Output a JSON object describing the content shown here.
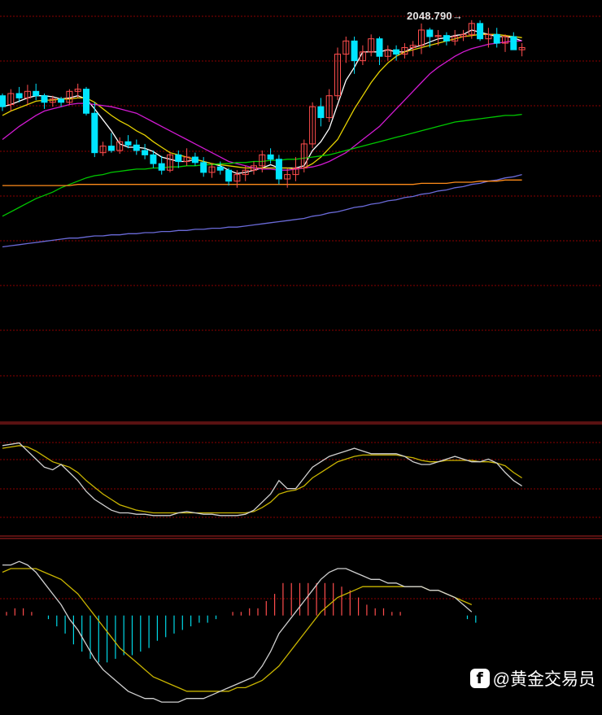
{
  "chart_data": {
    "type": "candlestick",
    "peak_label": "2048.790→",
    "colors": {
      "background": "#000000",
      "grid": "#8b0000",
      "panel_border": "#b22222",
      "candle_up": "#ff4d4d",
      "candle_down": "#00e5ff",
      "ma5": "#ffffff",
      "ma10": "#e6d200",
      "ma20": "#d21ad2",
      "ma60": "#00c800",
      "ma120": "#6a6ad8",
      "ma250": "#ff8c1a",
      "kdj_k": "#d0d0d0",
      "kdj_d": "#c8b400",
      "macd_dif": "#d0d0d0",
      "macd_dea": "#c8b400",
      "macd_pos": "#ff4d4d",
      "macd_neg": "#00d8e6"
    },
    "price_candles": [
      [
        1980,
        1982,
        1966,
        1970
      ],
      [
        1972,
        1986,
        1966,
        1982
      ],
      [
        1982,
        1988,
        1974,
        1978
      ],
      [
        1978,
        1990,
        1972,
        1984
      ],
      [
        1984,
        1991,
        1976,
        1980
      ],
      [
        1980,
        1982,
        1968,
        1974
      ],
      [
        1974,
        1980,
        1970,
        1977
      ],
      [
        1977,
        1979,
        1970,
        1974
      ],
      [
        1974,
        1986,
        1972,
        1984
      ],
      [
        1984,
        1991,
        1978,
        1986
      ],
      [
        1986,
        1988,
        1962,
        1964
      ],
      [
        1964,
        1974,
        1924,
        1928
      ],
      [
        1928,
        1938,
        1925,
        1934
      ],
      [
        1934,
        1946,
        1928,
        1930
      ],
      [
        1930,
        1942,
        1927,
        1938
      ],
      [
        1938,
        1944,
        1932,
        1935
      ],
      [
        1935,
        1940,
        1926,
        1930
      ],
      [
        1930,
        1936,
        1922,
        1926
      ],
      [
        1926,
        1930,
        1914,
        1918
      ],
      [
        1918,
        1925,
        1908,
        1912
      ],
      [
        1912,
        1928,
        1910,
        1926
      ],
      [
        1926,
        1930,
        1914,
        1920
      ],
      [
        1920,
        1932,
        1916,
        1924
      ],
      [
        1924,
        1928,
        1916,
        1919
      ],
      [
        1919,
        1924,
        1906,
        1910
      ],
      [
        1910,
        1918,
        1905,
        1915
      ],
      [
        1915,
        1920,
        1908,
        1912
      ],
      [
        1912,
        1914,
        1898,
        1902
      ],
      [
        1902,
        1912,
        1896,
        1908
      ],
      [
        1908,
        1916,
        1902,
        1912
      ],
      [
        1912,
        1920,
        1908,
        1916
      ],
      [
        1916,
        1930,
        1910,
        1926
      ],
      [
        1926,
        1932,
        1918,
        1922
      ],
      [
        1922,
        1926,
        1899,
        1904
      ],
      [
        1904,
        1914,
        1896,
        1908
      ],
      [
        1908,
        1924,
        1902,
        1914
      ],
      [
        1914,
        1940,
        1910,
        1936
      ],
      [
        1936,
        1974,
        1932,
        1970
      ],
      [
        1970,
        1978,
        1952,
        1960
      ],
      [
        1960,
        1986,
        1956,
        1980
      ],
      [
        1980,
        2024,
        1976,
        2018
      ],
      [
        2018,
        2034,
        2010,
        2030
      ],
      [
        2030,
        2034,
        2000,
        2012
      ],
      [
        2012,
        2026,
        2008,
        2020
      ],
      [
        2020,
        2036,
        2016,
        2032
      ],
      [
        2032,
        2034,
        2008,
        2016
      ],
      [
        2016,
        2026,
        2012,
        2022
      ],
      [
        2022,
        2026,
        2012,
        2018
      ],
      [
        2018,
        2028,
        2014,
        2024
      ],
      [
        2024,
        2030,
        2016,
        2026
      ],
      [
        2026,
        2046,
        2018,
        2040
      ],
      [
        2040,
        2042,
        2024,
        2034
      ],
      [
        2034,
        2040,
        2026,
        2035
      ],
      [
        2035,
        2038,
        2026,
        2030
      ],
      [
        2030,
        2040,
        2026,
        2034
      ],
      [
        2034,
        2040,
        2030,
        2036
      ],
      [
        2036,
        2049,
        2032,
        2046
      ],
      [
        2046,
        2048.79,
        2030,
        2032
      ],
      [
        2032,
        2042,
        2024,
        2036
      ],
      [
        2036,
        2042,
        2024,
        2028
      ],
      [
        2028,
        2036,
        2020,
        2034
      ],
      [
        2034,
        2038,
        2022,
        2022
      ],
      [
        2022,
        2028,
        2016,
        2024
      ]
    ],
    "ma_lines": [
      {
        "name": "MA5",
        "values": [
          1970,
          1972,
          1975,
          1978,
          1980,
          1980,
          1979,
          1977,
          1978,
          1980,
          1977,
          1968,
          1958,
          1948,
          1936,
          1933,
          1933,
          1932,
          1929,
          1924,
          1922,
          1920,
          1920,
          1922,
          1920,
          1918,
          1916,
          1912,
          1909,
          1910,
          1912,
          1914,
          1917,
          1914,
          1914,
          1914,
          1916,
          1930,
          1938,
          1950,
          1972,
          1994,
          2006,
          2020,
          2020,
          2020,
          2022,
          2020,
          2020,
          2024,
          2026,
          2029,
          2032,
          2033,
          2035,
          2036,
          2040,
          2038,
          2036,
          2034,
          2034,
          2033,
          2030
        ]
      },
      {
        "name": "MA10",
        "values": [
          1962,
          1966,
          1969,
          1972,
          1975,
          1976,
          1976,
          1977,
          1977,
          1978,
          1978,
          1974,
          1968,
          1962,
          1957,
          1953,
          1948,
          1944,
          1938,
          1933,
          1928,
          1926,
          1924,
          1922,
          1920,
          1918,
          1917,
          1916,
          1915,
          1914,
          1914,
          1914,
          1914,
          1914,
          1914,
          1913,
          1914,
          1918,
          1924,
          1932,
          1940,
          1954,
          1968,
          1980,
          1992,
          2002,
          2010,
          2016,
          2020,
          2022,
          2024,
          2026,
          2028,
          2030,
          2032,
          2034,
          2035,
          2036,
          2036,
          2036,
          2035,
          2034,
          2033
        ]
      },
      {
        "name": "MA20",
        "values": [
          1940,
          1946,
          1952,
          1957,
          1962,
          1966,
          1968,
          1970,
          1972,
          1973,
          1973,
          1972,
          1971,
          1970,
          1968,
          1966,
          1964,
          1960,
          1956,
          1952,
          1948,
          1944,
          1940,
          1936,
          1932,
          1928,
          1924,
          1920,
          1918,
          1916,
          1914,
          1913,
          1913,
          1912,
          1912,
          1913,
          1914,
          1915,
          1917,
          1920,
          1924,
          1928,
          1934,
          1940,
          1946,
          1952,
          1960,
          1968,
          1976,
          1984,
          1992,
          2000,
          2006,
          2011,
          2016,
          2020,
          2023,
          2025,
          2027,
          2028,
          2029,
          2030,
          2030
        ]
      },
      {
        "name": "MA60",
        "values": [
          1870,
          1874,
          1878,
          1882,
          1886,
          1889,
          1892,
          1896,
          1899,
          1902,
          1905,
          1907,
          1908,
          1910,
          1911,
          1912,
          1913,
          1913,
          1914,
          1914,
          1915,
          1915,
          1916,
          1916,
          1917,
          1917,
          1918,
          1918,
          1919,
          1919,
          1920,
          1920,
          1921,
          1921,
          1922,
          1922,
          1923,
          1924,
          1925,
          1926,
          1928,
          1930,
          1932,
          1934,
          1936,
          1938,
          1940,
          1942,
          1944,
          1946,
          1948,
          1950,
          1952,
          1954,
          1956,
          1957,
          1958,
          1959,
          1960,
          1961,
          1962,
          1962,
          1963
        ]
      },
      {
        "name": "MA120",
        "values": [
          1842,
          1843,
          1844,
          1845,
          1846,
          1847,
          1848,
          1849,
          1850,
          1850,
          1851,
          1852,
          1852,
          1853,
          1853,
          1854,
          1854,
          1855,
          1855,
          1856,
          1856,
          1857,
          1857,
          1858,
          1858,
          1859,
          1859,
          1860,
          1860,
          1861,
          1862,
          1863,
          1864,
          1865,
          1866,
          1867,
          1868,
          1870,
          1871,
          1873,
          1874,
          1876,
          1878,
          1879,
          1881,
          1882,
          1884,
          1885,
          1887,
          1888,
          1890,
          1891,
          1893,
          1894,
          1896,
          1897,
          1899,
          1900,
          1902,
          1903,
          1905,
          1906,
          1908
        ]
      },
      {
        "name": "MA250",
        "values": [
          1898,
          1898,
          1898,
          1898,
          1898,
          1898,
          1898,
          1898,
          1898,
          1899,
          1899,
          1899,
          1899,
          1899,
          1899,
          1899,
          1899,
          1899,
          1899,
          1899,
          1899,
          1899,
          1899,
          1899,
          1899,
          1899,
          1899,
          1899,
          1899,
          1899,
          1899,
          1899,
          1899,
          1899,
          1899,
          1899,
          1899,
          1899,
          1899,
          1899,
          1899,
          1899,
          1899,
          1899,
          1899,
          1899,
          1899,
          1899,
          1899,
          1899,
          1900,
          1900,
          1900,
          1900,
          1901,
          1901,
          1901,
          1902,
          1902,
          1902,
          1903,
          1903,
          1903
        ]
      }
    ],
    "price_ylim": [
      1800,
      2060
    ],
    "kdj": {
      "k": [
        78,
        79,
        80,
        74,
        68,
        62,
        60,
        64,
        58,
        52,
        44,
        38,
        34,
        30,
        28,
        28,
        27,
        27,
        26,
        26,
        26,
        28,
        29,
        28,
        27,
        27,
        26,
        26,
        26,
        27,
        30,
        36,
        42,
        52,
        46,
        46,
        54,
        62,
        66,
        70,
        72,
        74,
        76,
        74,
        72,
        72,
        72,
        72,
        70,
        66,
        64,
        64,
        66,
        68,
        70,
        68,
        66,
        66,
        68,
        65,
        58,
        52,
        48
      ],
      "d": [
        76,
        77,
        78,
        77,
        74,
        70,
        66,
        64,
        62,
        58,
        52,
        47,
        42,
        38,
        34,
        32,
        30,
        29,
        28,
        28,
        28,
        28,
        28,
        28,
        28,
        28,
        28,
        28,
        28,
        28,
        29,
        32,
        36,
        42,
        44,
        45,
        48,
        54,
        58,
        62,
        66,
        68,
        70,
        71,
        71,
        71,
        71,
        71,
        70,
        69,
        67,
        66,
        66,
        67,
        67,
        67,
        67,
        66,
        66,
        65,
        63,
        58,
        54
      ],
      "ylim": [
        15,
        90
      ]
    },
    "macd": {
      "dif": [
        14,
        14,
        15,
        14,
        12,
        9,
        6,
        3,
        -1,
        -4,
        -8,
        -12,
        -15,
        -17,
        -19,
        -21,
        -22,
        -23,
        -23,
        -24,
        -24,
        -24,
        -23,
        -23,
        -23,
        -22,
        -21,
        -20,
        -19,
        -18,
        -17,
        -14,
        -10,
        -5,
        -2,
        1,
        4,
        7,
        10,
        12,
        13,
        13,
        12,
        11,
        10,
        10,
        9,
        9,
        8,
        8,
        8,
        7,
        7,
        6,
        5,
        3,
        1
      ],
      "dea": [
        12,
        13,
        13,
        13,
        13,
        12,
        11,
        10,
        8,
        6,
        3,
        0,
        -3,
        -6,
        -9,
        -11,
        -13,
        -15,
        -17,
        -18,
        -19,
        -20,
        -21,
        -21,
        -21,
        -21,
        -21,
        -21,
        -20,
        -20,
        -19,
        -18,
        -16,
        -14,
        -11,
        -8,
        -5,
        -2,
        1,
        3,
        5,
        6,
        7,
        8,
        8,
        8,
        8,
        8,
        8,
        8,
        8,
        7,
        7,
        6,
        5,
        4,
        3
      ],
      "hist": [
        1,
        2,
        2,
        1,
        0,
        -1,
        -3,
        -5,
        -8,
        -10,
        -12,
        -13,
        -13,
        -12,
        -11,
        -11,
        -10,
        -9,
        -7,
        -6,
        -5,
        -4,
        -3,
        -2,
        -2,
        -1,
        0,
        1,
        1,
        2,
        2,
        4,
        6,
        9,
        9,
        9,
        9,
        9,
        9,
        9,
        8,
        7,
        5,
        3,
        2,
        2,
        1,
        1,
        0,
        0,
        0,
        0,
        0,
        0,
        0,
        -1,
        -2
      ],
      "ylim": [
        -26,
        20
      ]
    }
  },
  "watermark": {
    "logo_letter": "f",
    "text": "@黄金交易员"
  }
}
